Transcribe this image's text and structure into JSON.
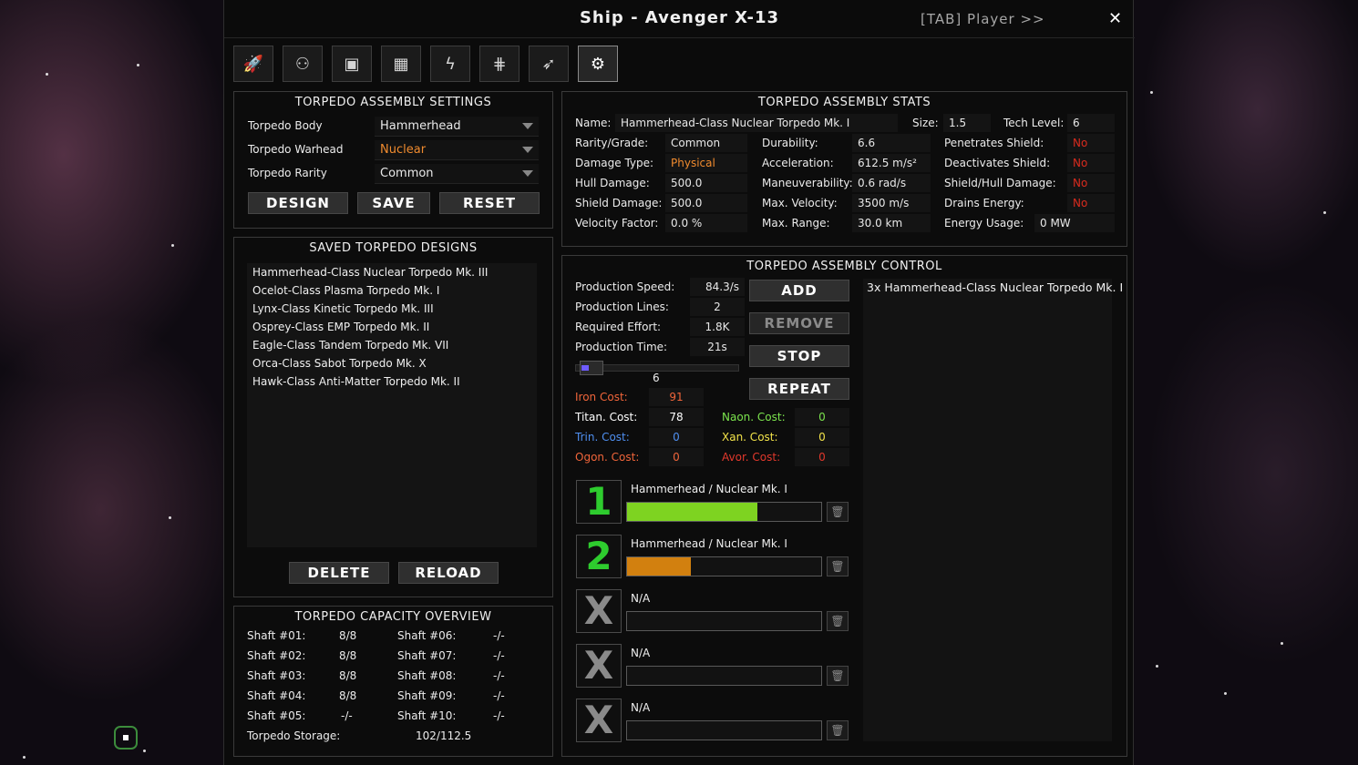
{
  "window": {
    "title": "Ship - Avenger X-13",
    "player_link": "[TAB] Player   >>",
    "close_label": "✕"
  },
  "tabs": [
    {
      "icon": "ship-icon",
      "glyph": "🚀"
    },
    {
      "icon": "crew-icon",
      "glyph": "⚇"
    },
    {
      "icon": "schematic-icon",
      "glyph": "▣"
    },
    {
      "icon": "cargo-icon",
      "glyph": "▦"
    },
    {
      "icon": "energy-icon",
      "glyph": "ϟ"
    },
    {
      "icon": "grid-icon",
      "glyph": "⋕"
    },
    {
      "icon": "missile-icon",
      "glyph": "➶"
    },
    {
      "icon": "torpedo-assembly-icon",
      "glyph": "⚙"
    }
  ],
  "settings": {
    "header": "TORPEDO ASSEMBLY SETTINGS",
    "rows": [
      {
        "label": "Torpedo Body",
        "value": "Hammerhead"
      },
      {
        "label": "Torpedo Warhead",
        "value": "Nuclear"
      },
      {
        "label": "Torpedo Rarity",
        "value": "Common"
      }
    ],
    "design": "DESIGN",
    "save": "SAVE",
    "reset": "RESET"
  },
  "saved": {
    "header": "SAVED TORPEDO DESIGNS",
    "items": [
      "Hammerhead-Class Nuclear Torpedo Mk. III",
      "Ocelot-Class Plasma Torpedo Mk. I",
      "Lynx-Class Kinetic Torpedo Mk. III",
      "Osprey-Class EMP Torpedo Mk. II",
      "Eagle-Class Tandem Torpedo Mk. VII",
      "Orca-Class Sabot Torpedo Mk. X",
      "Hawk-Class Anti-Matter Torpedo Mk. II"
    ],
    "delete": "DELETE",
    "reload": "RELOAD"
  },
  "capacity": {
    "header": "TORPEDO CAPACITY OVERVIEW",
    "left": [
      {
        "label": "Shaft #01:",
        "value": "8/8"
      },
      {
        "label": "Shaft #02:",
        "value": "8/8"
      },
      {
        "label": "Shaft #03:",
        "value": "8/8"
      },
      {
        "label": "Shaft #04:",
        "value": "8/8"
      },
      {
        "label": "Shaft #05:",
        "value": "-/-"
      }
    ],
    "right": [
      {
        "label": "Shaft #06:",
        "value": "-/-"
      },
      {
        "label": "Shaft #07:",
        "value": "-/-"
      },
      {
        "label": "Shaft #08:",
        "value": "-/-"
      },
      {
        "label": "Shaft #09:",
        "value": "-/-"
      },
      {
        "label": "Shaft #10:",
        "value": "-/-"
      }
    ],
    "storage_label": "Torpedo Storage:",
    "storage_value": "102/112.5"
  },
  "stats": {
    "header": "TORPEDO ASSEMBLY STATS",
    "name_label": "Name:",
    "name_value": "Hammerhead-Class Nuclear Torpedo Mk. I",
    "size_label": "Size:",
    "size_value": "1.5",
    "tech_label": "Tech Level:",
    "tech_value": "6",
    "col1": [
      {
        "label": "Rarity/Grade:",
        "value": "Common"
      },
      {
        "label": "Damage Type:",
        "value": "Physical"
      },
      {
        "label": "Hull Damage:",
        "value": "500.0"
      },
      {
        "label": "Shield Damage:",
        "value": "500.0"
      },
      {
        "label": "Velocity Factor:",
        "value": "0.0 %"
      }
    ],
    "col2": [
      {
        "label": "Durability:",
        "value": "6.6"
      },
      {
        "label": "Acceleration:",
        "value": "612.5 m/s²"
      },
      {
        "label": "Maneuverability:",
        "value": "0.6 rad/s"
      },
      {
        "label": "Max. Velocity:",
        "value": "3500 m/s"
      },
      {
        "label": "Max. Range:",
        "value": "30.0 km"
      }
    ],
    "col3": [
      {
        "label": "Penetrates Shield:",
        "value": "No"
      },
      {
        "label": "Deactivates Shield:",
        "value": "No"
      },
      {
        "label": "Shield/Hull Damage:",
        "value": "No"
      },
      {
        "label": "Drains Energy:",
        "value": "No"
      },
      {
        "label": "Energy Usage:",
        "value": "0 MW"
      }
    ]
  },
  "control": {
    "header": "TORPEDO ASSEMBLY CONTROL",
    "rows": [
      {
        "label": "Production Speed:",
        "value": "84.3/s"
      },
      {
        "label": "Production Lines:",
        "value": "2"
      },
      {
        "label": "Required Effort:",
        "value": "1.8K"
      },
      {
        "label": "Production Time:",
        "value": "21s"
      }
    ],
    "slider_value": "6",
    "slider_fraction": 0.05,
    "add": "ADD",
    "remove": "REMOVE",
    "stop": "STOP",
    "repeat": "REPEAT",
    "costs_left": [
      {
        "label": "Iron Cost:",
        "value": "91",
        "color": "#f0653a"
      },
      {
        "label": "Titan. Cost:",
        "value": "78",
        "color": "#ffffff"
      },
      {
        "label": "Trin. Cost:",
        "value": "0",
        "color": "#4f8ff0"
      },
      {
        "label": "Ogon. Cost:",
        "value": "0",
        "color": "#f0653a"
      }
    ],
    "costs_right": [
      {
        "label": "Naon. Cost:",
        "value": "0",
        "color": "#7be34d"
      },
      {
        "label": "Xan. Cost:",
        "value": "0",
        "color": "#f2e34a"
      },
      {
        "label": "Avor. Cost:",
        "value": "0",
        "color": "#e2382c"
      }
    ],
    "lines": [
      {
        "number": "1",
        "name": "Hammerhead / Nuclear Mk. I",
        "progress": 0.67,
        "color": "#7ed321",
        "numcolor": "#2ecc2e"
      },
      {
        "number": "2",
        "name": "Hammerhead / Nuclear Mk. I",
        "progress": 0.33,
        "color": "#d2800f",
        "numcolor": "#2ecc2e"
      },
      {
        "number": "X",
        "name": "N/A",
        "progress": 0,
        "color": "#888",
        "numcolor": "#8a8a8a"
      },
      {
        "number": "X",
        "name": "N/A",
        "progress": 0,
        "color": "#888",
        "numcolor": "#8a8a8a"
      },
      {
        "number": "X",
        "name": "N/A",
        "progress": 0,
        "color": "#888",
        "numcolor": "#8a8a8a"
      }
    ],
    "queue": [
      "3x Hammerhead-Class Nuclear Torpedo Mk. I"
    ]
  }
}
